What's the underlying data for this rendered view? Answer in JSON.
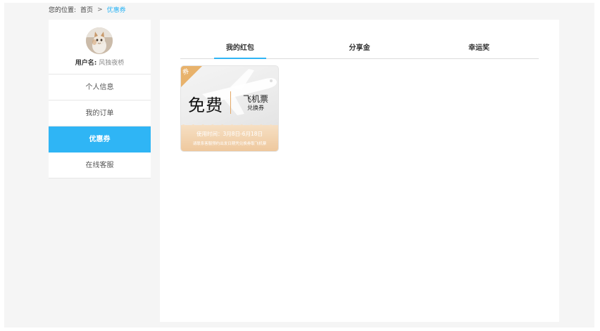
{
  "breadcrumb": {
    "prefix": "您的位置:",
    "home": "首页",
    "separator": ">",
    "current": "优惠券"
  },
  "sidebar": {
    "username_label": "用户名:",
    "username_value": "风独夜桥",
    "items": [
      {
        "label": "个人信息",
        "active": false
      },
      {
        "label": "我的订单",
        "active": false
      },
      {
        "label": "优惠券",
        "active": true
      },
      {
        "label": "在线客服",
        "active": false
      }
    ]
  },
  "tabs": [
    {
      "label": "我的红包",
      "active": true
    },
    {
      "label": "分享金",
      "active": false
    },
    {
      "label": "幸运奖",
      "active": false
    }
  ],
  "coupon": {
    "ribbon": "券",
    "free": "免费",
    "title": "飞机票",
    "subtitle": "兑换券",
    "time": "使用时间：3月8日-6月18日",
    "note": "请联系客服预约出发日期凭兑换券取飞机票"
  },
  "colors": {
    "accent": "#2fb5f5",
    "coupon_gold": "#eec79c",
    "ribbon": "#e8b26b"
  },
  "icons": {
    "avatar": "cat-photo",
    "plane": "airplane-illustration"
  }
}
